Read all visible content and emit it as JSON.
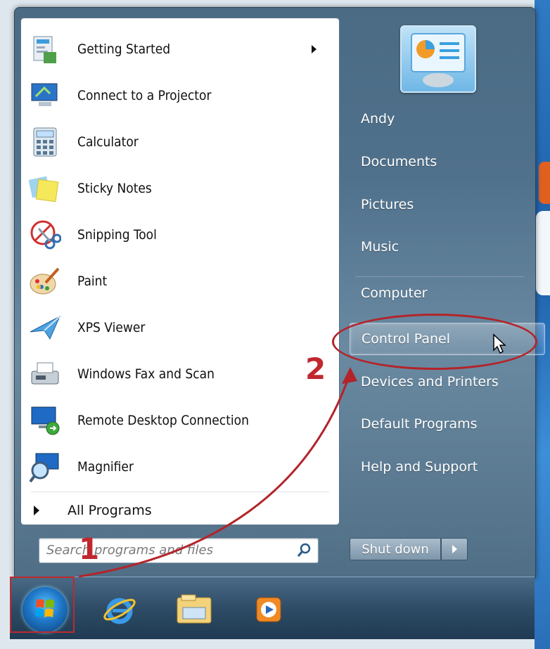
{
  "programs": [
    {
      "label": "Getting Started",
      "icon": "getting-started-icon",
      "has_submenu": true
    },
    {
      "label": "Connect to a Projector",
      "icon": "projector-icon"
    },
    {
      "label": "Calculator",
      "icon": "calculator-icon"
    },
    {
      "label": "Sticky Notes",
      "icon": "sticky-notes-icon"
    },
    {
      "label": "Snipping Tool",
      "icon": "snipping-tool-icon"
    },
    {
      "label": "Paint",
      "icon": "paint-icon"
    },
    {
      "label": "XPS Viewer",
      "icon": "xps-viewer-icon"
    },
    {
      "label": "Windows Fax and Scan",
      "icon": "fax-scan-icon"
    },
    {
      "label": "Remote Desktop Connection",
      "icon": "remote-desktop-icon"
    },
    {
      "label": "Magnifier",
      "icon": "magnifier-icon"
    }
  ],
  "all_programs": "All Programs",
  "search": {
    "placeholder": "Search programs and files"
  },
  "right_items": [
    {
      "label": "Andy"
    },
    {
      "label": "Documents"
    },
    {
      "label": "Pictures"
    },
    {
      "label": "Music"
    },
    {
      "label": "Computer"
    },
    {
      "label": "Control Panel",
      "highlighted": true
    },
    {
      "label": "Devices and Printers"
    },
    {
      "label": "Default Programs"
    },
    {
      "label": "Help and Support"
    }
  ],
  "shutdown": {
    "label": "Shut down"
  },
  "annotations": {
    "step1": "1",
    "step2": "2"
  },
  "colors": {
    "annotation": "#c0282e",
    "menu_bg": "#50718c"
  }
}
